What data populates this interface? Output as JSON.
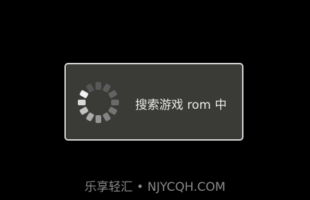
{
  "dialog": {
    "message": "搜索游戏 rom 中",
    "spinner_icon": "loading-spinner-icon"
  },
  "watermark": {
    "text": "乐享轻汇 • NJYCQH.COM"
  },
  "colors": {
    "background": "#000000",
    "dialog_fill": "#3a3b37",
    "dialog_border": "#d8d8d8",
    "text": "#ebebeb",
    "watermark": "#8a8a8a"
  }
}
